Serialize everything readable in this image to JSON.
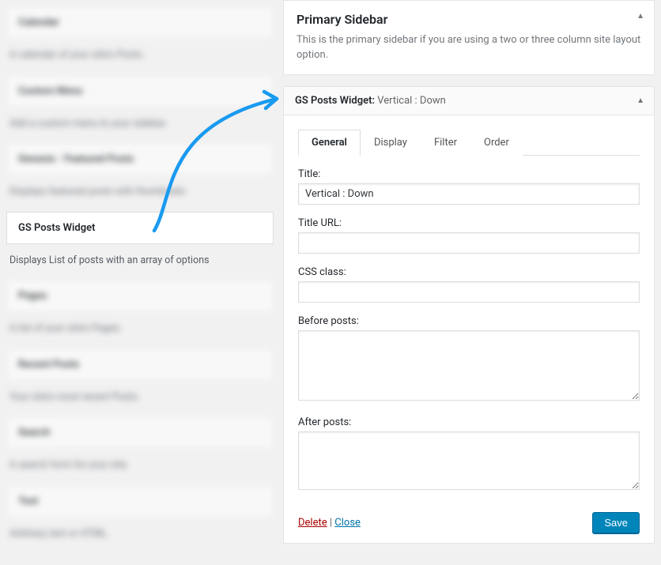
{
  "available_widgets": [
    {
      "title": "Calendar",
      "desc": "A calendar of your site's Posts."
    },
    {
      "title": "Custom Menu",
      "desc": "Add a custom menu to your sidebar."
    },
    {
      "title": "Genesis - Featured Posts",
      "desc": "Displays featured posts with thumbnails"
    }
  ],
  "gs_widget": {
    "title": "GS Posts Widget",
    "desc": "Displays List of posts with an array of options"
  },
  "available_widgets_after": [
    {
      "title": "Pages",
      "desc": "A list of your site's Pages."
    },
    {
      "title": "Recent Posts",
      "desc": "Your site's most recent Posts."
    },
    {
      "title": "Search",
      "desc": "A search form for your site."
    },
    {
      "title": "Text",
      "desc": "Arbitrary text or HTML."
    }
  ],
  "sidebar_area": {
    "title": "Primary Sidebar",
    "desc": "This is the primary sidebar if you are using a two or three column site layout option."
  },
  "expanded_widget": {
    "name": "GS Posts Widget:",
    "subtitle": "Vertical : Down"
  },
  "tabs": [
    "General",
    "Display",
    "Filter",
    "Order"
  ],
  "form": {
    "title_label": "Title:",
    "title_value": "Vertical : Down",
    "title_url_label": "Title URL:",
    "title_url_value": "",
    "css_class_label": "CSS class:",
    "css_class_value": "",
    "before_posts_label": "Before posts:",
    "before_posts_value": "",
    "after_posts_label": "After posts:",
    "after_posts_value": ""
  },
  "footer": {
    "delete": "Delete",
    "sep": "|",
    "close": "Close",
    "save": "Save"
  }
}
